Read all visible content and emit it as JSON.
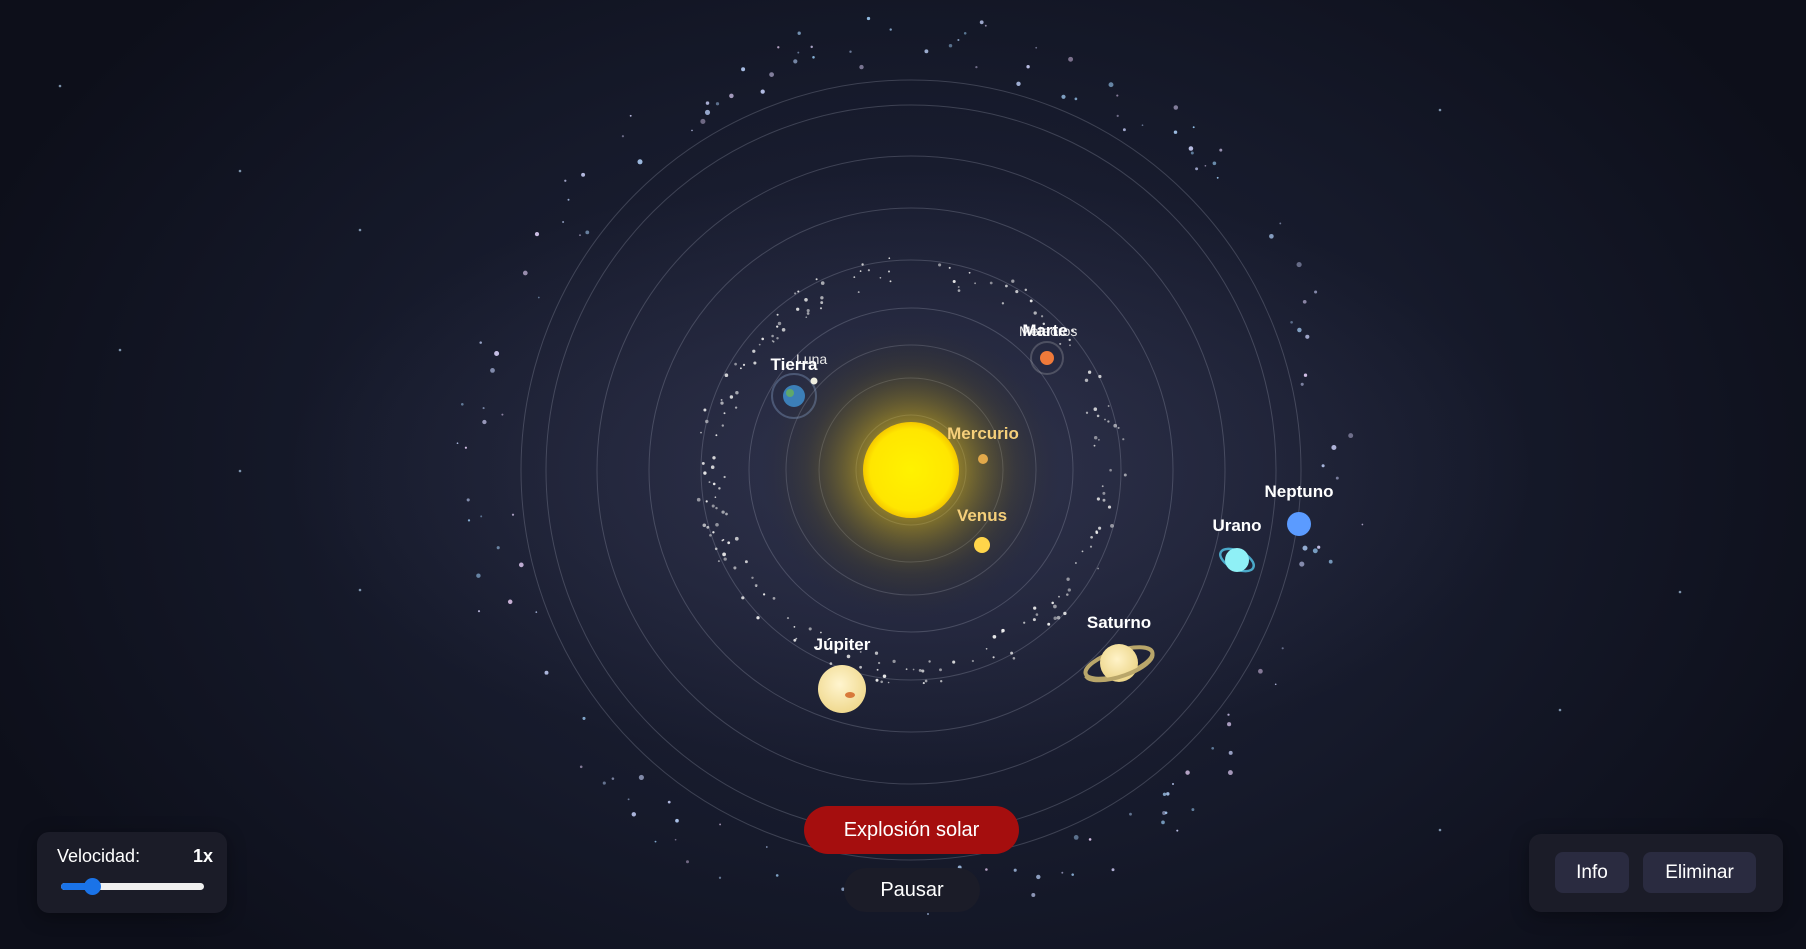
{
  "scene": {
    "sun": {
      "name": "sol",
      "color": "#ffe500"
    },
    "planets": [
      {
        "id": "mercurio",
        "label": "Mercurio",
        "label_color": "#f5cf7a",
        "color": "#e2a94a"
      },
      {
        "id": "venus",
        "label": "Venus",
        "label_color": "#f5cf7a",
        "color": "#ffd54a"
      },
      {
        "id": "tierra",
        "label": "Tierra",
        "label_color": "#ffffff",
        "color": "#3c7fb8"
      },
      {
        "id": "luna",
        "label": "Luna",
        "label_color": "#e8e8e8",
        "color": "#f0efe0"
      },
      {
        "id": "marte",
        "label": "Marte",
        "label_color": "#ffffff",
        "color": "#f07a3a"
      },
      {
        "id": "jupiter",
        "label": "Júpiter",
        "label_color": "#ffffff",
        "color": "#f8e4a8"
      },
      {
        "id": "saturno",
        "label": "Saturno",
        "label_color": "#ffffff",
        "color": "#f7e2a0"
      },
      {
        "id": "urano",
        "label": "Urano",
        "label_color": "#ffffff",
        "color": "#8ff0f6"
      },
      {
        "id": "neptuno",
        "label": "Neptuno",
        "label_color": "#ffffff",
        "color": "#5b9bff"
      }
    ],
    "asteroid_label": "Meteoros"
  },
  "controls": {
    "speed_label": "Velocidad:",
    "speed_value": "1x",
    "speed_fraction": 0.08,
    "explosion_label": "Explosión solar",
    "pause_label": "Pausar",
    "info_label": "Info",
    "delete_label": "Eliminar"
  },
  "colors": {
    "explosion_button": "#a50e0e",
    "slider_accent": "#1a73e8",
    "panel_bg": "#1b1c28"
  }
}
